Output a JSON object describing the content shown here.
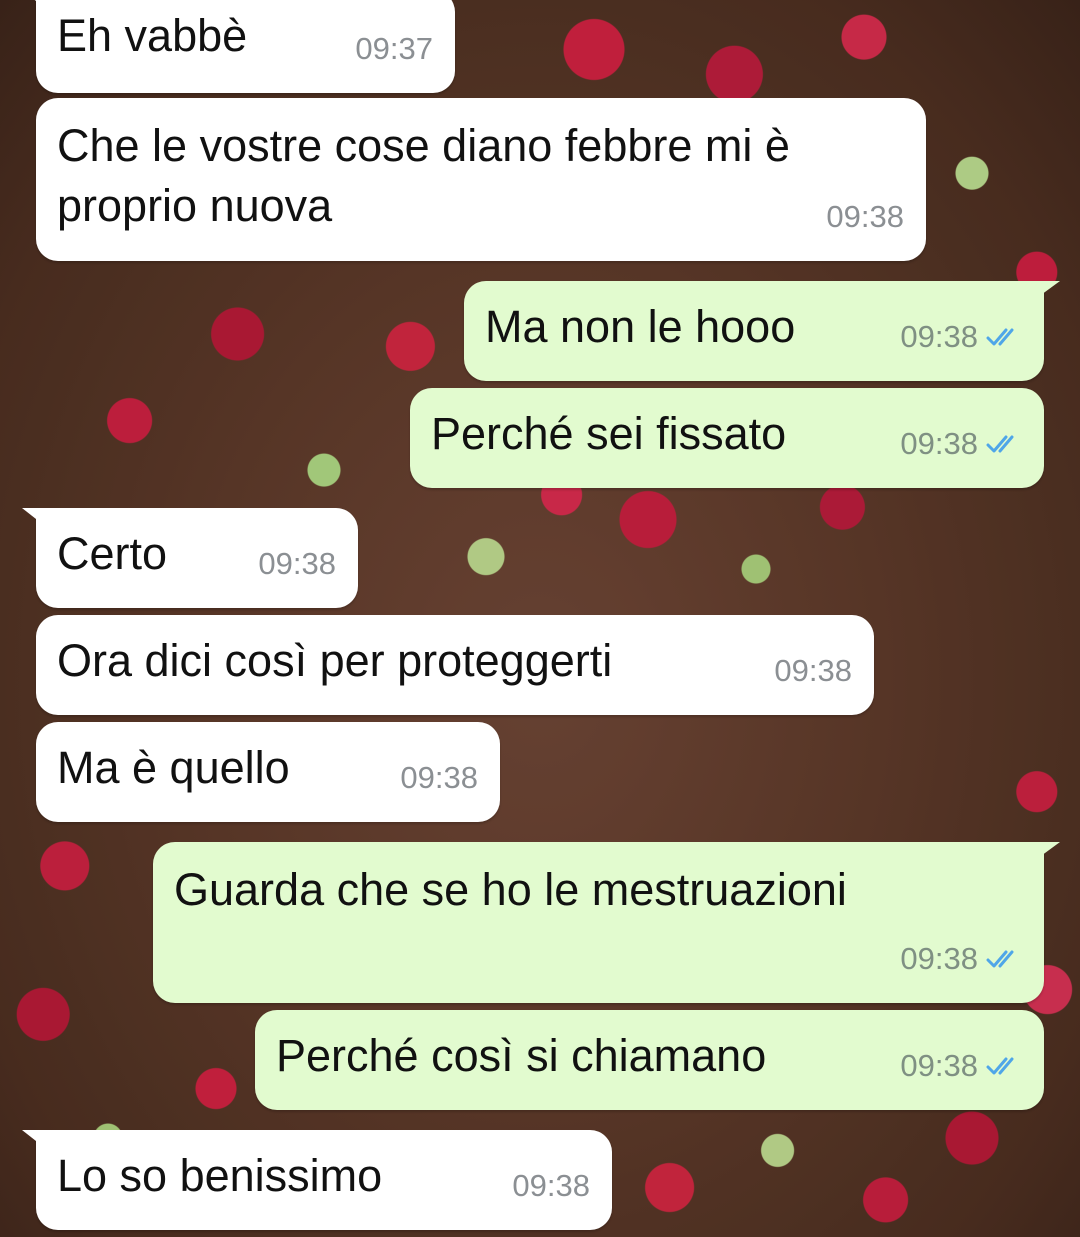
{
  "messages": [
    {
      "dir": "in",
      "text": "Eh vabbè",
      "time": "09:37"
    },
    {
      "dir": "in",
      "text": "Che le vostre cose diano febbre mi è proprio nuova",
      "time": "09:38"
    },
    {
      "dir": "out",
      "text": "Ma non le hooo",
      "time": "09:38",
      "status": "read-double-check-icon"
    },
    {
      "dir": "out",
      "text": "Perché sei fissato",
      "time": "09:38",
      "status": "read-double-check-icon"
    },
    {
      "dir": "in",
      "text": "Certo",
      "time": "09:38"
    },
    {
      "dir": "in",
      "text": "Ora dici così per proteggerti",
      "time": "09:38"
    },
    {
      "dir": "in",
      "text": "Ma è quello",
      "time": "09:38"
    },
    {
      "dir": "out",
      "text": "Guarda che se ho le mestruazioni",
      "time": "09:38",
      "status": "read-double-check-icon"
    },
    {
      "dir": "out",
      "text": "Perché così si chiamano",
      "time": "09:38",
      "status": "read-double-check-icon"
    },
    {
      "dir": "in",
      "text": "Lo so benissimo",
      "time": "09:38"
    }
  ],
  "colors": {
    "incoming_bubble": "#ffffff",
    "outgoing_bubble": "#e2fbcf",
    "read_ticks": "#4fa6e8",
    "timestamp": "#8b8f93"
  }
}
